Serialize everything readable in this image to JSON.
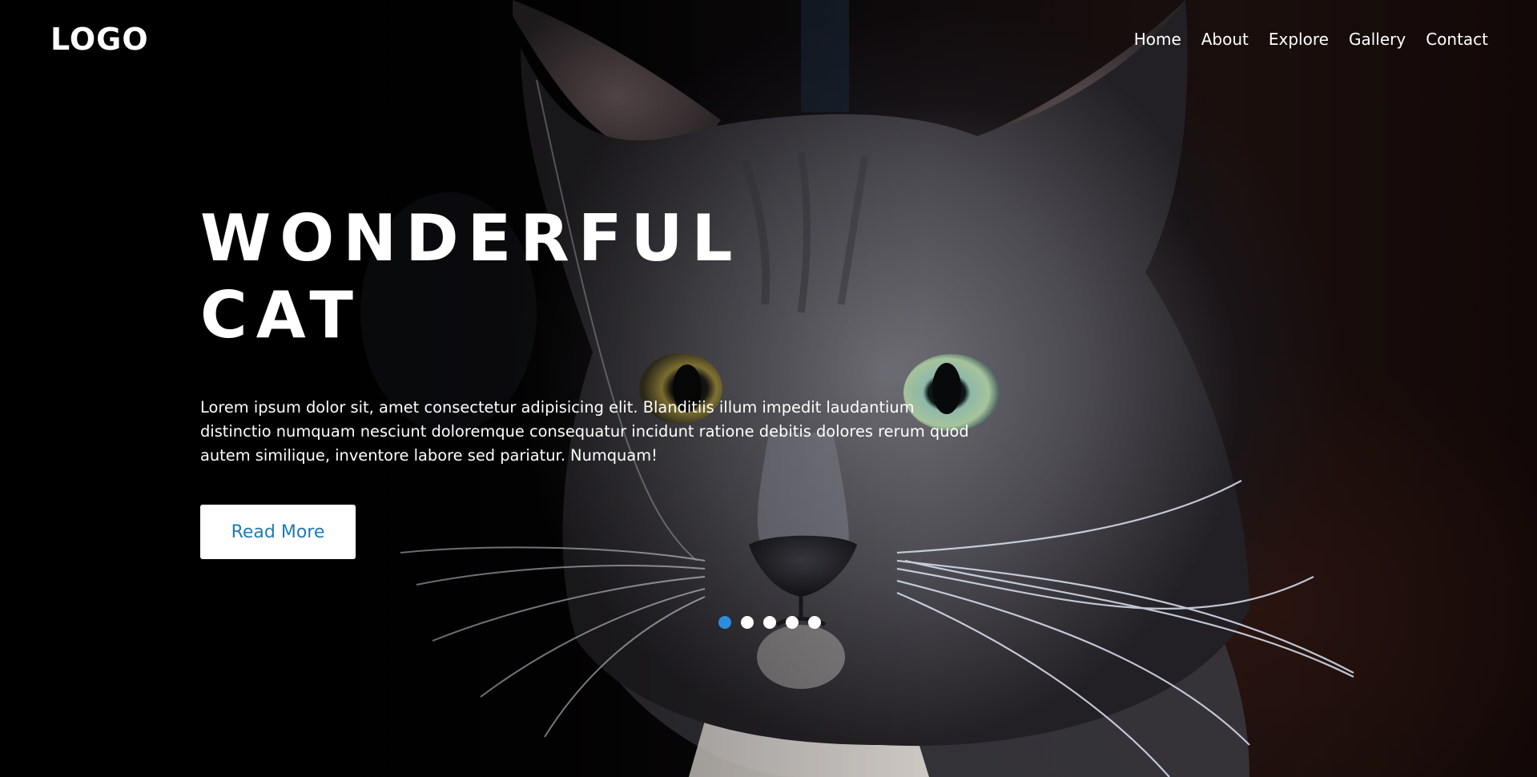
{
  "header": {
    "logo": "LOGO",
    "nav": [
      "Home",
      "About",
      "Explore",
      "Gallery",
      "Contact"
    ]
  },
  "hero": {
    "title_line1": "WONDERFUL",
    "title_line2": "CAT",
    "description": "Lorem ipsum dolor sit, amet consectetur adipisicing elit. Blanditiis illum impedit laudantium distinctio numquam nesciunt doloremque consequatur incidunt ratione debitis dolores rerum quod autem similique, inventore labore sed pariatur. Numquam!",
    "button_label": "Read More",
    "background_image": "cat-photo",
    "slider": {
      "slides": 5,
      "active_index": 0
    }
  },
  "colors": {
    "accent": "#2a8ee0",
    "button_text": "#1d7cb7",
    "text": "#ffffff",
    "background": "#000000"
  }
}
